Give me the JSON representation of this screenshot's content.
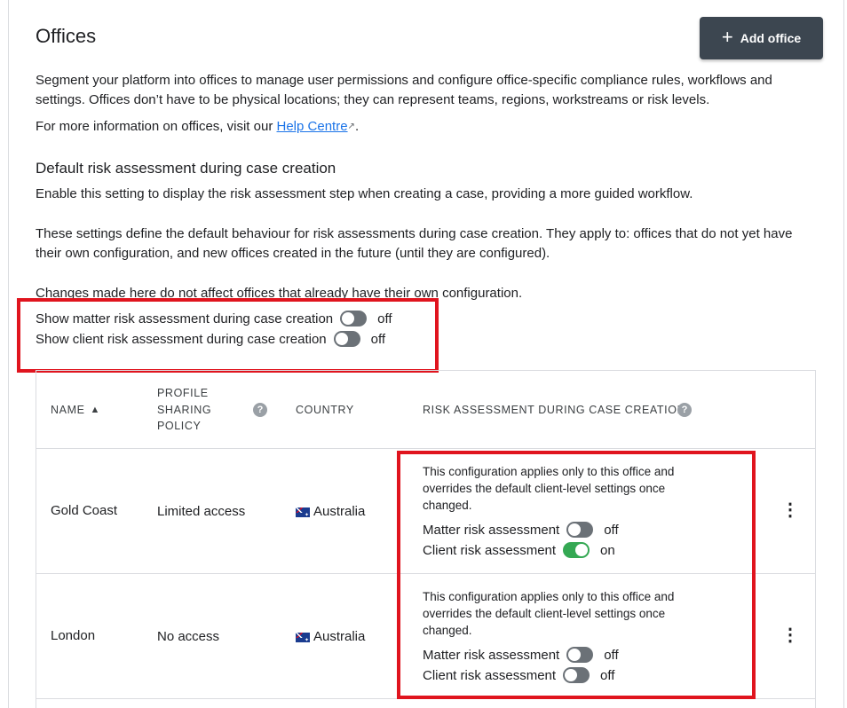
{
  "header": {
    "title": "Offices",
    "add_button": "Add office",
    "add_icon": "plus-icon"
  },
  "intro": {
    "text": "Segment your platform into offices to manage user permissions and configure office-specific compliance rules, workflows and settings. Offices don’t have to be physical locations; they can represent teams, regions, workstreams or risk levels.",
    "more_prefix": "For more information on offices, visit our",
    "link": "Help Centre",
    "link_icon": "↗",
    "suffix": "."
  },
  "defaults": {
    "heading": "Default risk assessment during case creation",
    "desc1": "Enable this setting to display the risk assessment step when creating a case, providing a more guided workflow.",
    "desc2": "These settings define the default behaviour for risk assessments during case creation. They apply to: offices that do not yet have their own configuration, and new offices created in the future (until they are configured).",
    "desc3": "Changes made here do not affect offices that already have their own configuration.",
    "matter_label": "Show matter risk assessment during case creation",
    "matter_state": "off",
    "client_label": "Show client risk assessment during case creation",
    "client_state": "off"
  },
  "table": {
    "columns": {
      "name": "NAME",
      "sort_icon": "▲",
      "policy": "PROFILE SHARING POLICY",
      "country": "COUNTRY",
      "risk": "RISK ASSESSMENT DURING CASE CREATION"
    },
    "help_glyph": "?",
    "rows": [
      {
        "name": "Gold Coast",
        "policy": "Limited access",
        "country": "Australia",
        "note": "This configuration applies only to this office and overrides the default client-level settings once changed.",
        "matter_label": "Matter risk assessment",
        "matter_state": "off",
        "client_label": "Client risk assessment",
        "client_state": "on"
      },
      {
        "name": "London",
        "policy": "No access",
        "country": "Australia",
        "note": "This configuration applies only to this office and overrides the default client-level settings once changed.",
        "matter_label": "Matter risk assessment",
        "matter_state": "off",
        "client_label": "Client risk assessment",
        "client_state": "off"
      }
    ],
    "kebab_glyph": "⋮"
  },
  "colors": {
    "highlight": "#e0141e",
    "toggle_on": "#34a853",
    "toggle_off": "#6b7177",
    "button_bg": "#3c4650",
    "link": "#1a73e8"
  }
}
